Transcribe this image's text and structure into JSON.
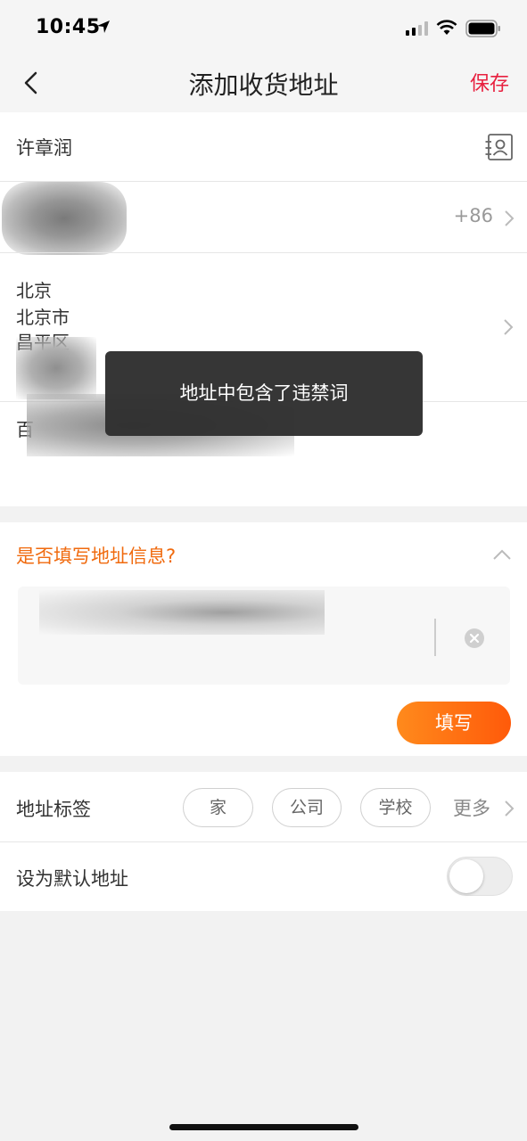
{
  "status_bar": {
    "time": "10:45"
  },
  "nav": {
    "title": "添加收货地址",
    "save_label": "保存"
  },
  "form": {
    "name": "许章润",
    "phone_code": "+86",
    "region_lines": [
      "北京",
      "北京市",
      "昌平区"
    ],
    "detail_prefix": "百"
  },
  "toast": {
    "message": "地址中包含了违禁词"
  },
  "smart_fill": {
    "title": "是否填写地址信息?",
    "fill_label": "填写"
  },
  "tags": {
    "label": "地址标签",
    "items": [
      "家",
      "公司",
      "学校"
    ],
    "more_label": "更多"
  },
  "default_address": {
    "label": "设为默认地址",
    "enabled": false
  },
  "colors": {
    "accent_red": "#e8203f",
    "accent_orange": "#f06a0e"
  }
}
